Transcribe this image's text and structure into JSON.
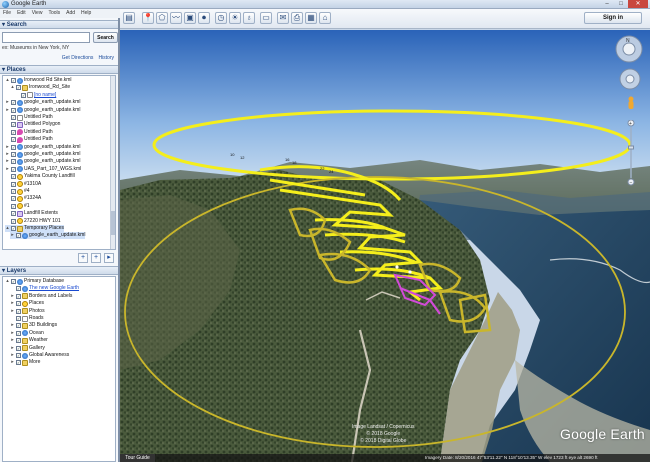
{
  "window": {
    "title": "Google Earth",
    "min": "–",
    "max": "□",
    "close": "✕"
  },
  "menu": [
    "File",
    "Edit",
    "View",
    "Tools",
    "Add",
    "Help"
  ],
  "toolbar": {
    "sign_in": "Sign in"
  },
  "search": {
    "header": "Search",
    "value": "",
    "button": "Search",
    "result": "ex: Museums in New York, NY",
    "get_directions": "Get Directions",
    "history": "History"
  },
  "places": {
    "header": "Places",
    "items": [
      {
        "label": "Ironwood Rd Site.kml",
        "icon": "kml",
        "indent": 0,
        "exp": "▴"
      },
      {
        "label": "Ironwood_Rd_Site",
        "icon": "folder",
        "indent": 1,
        "exp": "▴"
      },
      {
        "label": "[no name]",
        "icon": "path",
        "indent": 2,
        "exp": "",
        "link": true
      },
      {
        "label": "google_earth_update.kml",
        "icon": "kml",
        "indent": 0,
        "exp": "▸"
      },
      {
        "label": "google_earth_update.kml",
        "icon": "kml",
        "indent": 0,
        "exp": "▸"
      },
      {
        "label": "Untitled Path",
        "icon": "path",
        "indent": 0,
        "exp": ""
      },
      {
        "label": "Untitled Polygon",
        "icon": "poly",
        "indent": 0,
        "exp": ""
      },
      {
        "label": "Untitled Path",
        "icon": "pin",
        "indent": 0,
        "exp": ""
      },
      {
        "label": "Untitled Path",
        "icon": "pin",
        "indent": 0,
        "exp": ""
      },
      {
        "label": "google_earth_update.kml",
        "icon": "kml",
        "indent": 0,
        "exp": "▸"
      },
      {
        "label": "google_earth_update.kml",
        "icon": "kml",
        "indent": 0,
        "exp": "▸"
      },
      {
        "label": "google_earth_update.kml",
        "icon": "kml",
        "indent": 0,
        "exp": "▸"
      },
      {
        "label": "UAS_Part_107_WGS.kml",
        "icon": "kml",
        "indent": 0,
        "exp": "▸"
      },
      {
        "label": "Yakima County Landfill",
        "icon": "place",
        "indent": 0,
        "exp": ""
      },
      {
        "label": "#1310A",
        "icon": "place",
        "indent": 0,
        "exp": ""
      },
      {
        "label": "#4",
        "icon": "place",
        "indent": 0,
        "exp": ""
      },
      {
        "label": "#1324A",
        "icon": "place",
        "indent": 0,
        "exp": ""
      },
      {
        "label": "#1",
        "icon": "place",
        "indent": 0,
        "exp": ""
      },
      {
        "label": "Landfill Extents",
        "icon": "poly",
        "indent": 0,
        "exp": ""
      },
      {
        "label": "27220 HWY 101",
        "icon": "place",
        "indent": 0,
        "exp": ""
      },
      {
        "label": "Temporary Places",
        "icon": "folder",
        "indent": 0,
        "exp": "▴",
        "selected": true
      },
      {
        "label": "google_earth_update.kml",
        "icon": "kml",
        "indent": 1,
        "exp": "▸",
        "selected": true
      }
    ],
    "tools": [
      "+",
      "+",
      "▸"
    ]
  },
  "layers": {
    "header": "Layers",
    "items": [
      {
        "label": "Primary Database",
        "icon": "kml",
        "indent": 0,
        "exp": "▴"
      },
      {
        "label": "The new Google Earth",
        "icon": "kml",
        "indent": 1,
        "exp": "",
        "link": true
      },
      {
        "label": "Borders and Labels",
        "icon": "folder",
        "indent": 1,
        "exp": "▸"
      },
      {
        "label": "Places",
        "icon": "place",
        "indent": 1,
        "exp": "▸"
      },
      {
        "label": "Photos",
        "icon": "folder",
        "indent": 1,
        "exp": "▸"
      },
      {
        "label": "Roads",
        "icon": "path",
        "indent": 1,
        "exp": ""
      },
      {
        "label": "3D Buildings",
        "icon": "folder",
        "indent": 1,
        "exp": "▸"
      },
      {
        "label": "Ocean",
        "icon": "kml",
        "indent": 1,
        "exp": "▸"
      },
      {
        "label": "Weather",
        "icon": "folder",
        "indent": 1,
        "exp": "▸"
      },
      {
        "label": "Gallery",
        "icon": "folder",
        "indent": 1,
        "exp": "▸"
      },
      {
        "label": "Global Awareness",
        "icon": "kml",
        "indent": 1,
        "exp": "▸"
      },
      {
        "label": "More",
        "icon": "folder",
        "indent": 1,
        "exp": "▸"
      }
    ]
  },
  "view": {
    "copyright": "Image Landsat / Copernicus",
    "copyright2": "© 2018 Google",
    "copyright3": "© 2018 Digital Globe",
    "watermark": "Google Earth",
    "tour_guide": "Tour Guide",
    "status": "Imagery Date: 8/20/2016   47°53'11.22\" N  118°10'13.35\" W   elev  1723 ft     eye alt  2690 ft"
  },
  "colors": {
    "flight_path": "#f4ee1c",
    "survey_zone": "#c9b62b",
    "poly_highlight": "#d24ad8",
    "water": "#1d3b55"
  }
}
